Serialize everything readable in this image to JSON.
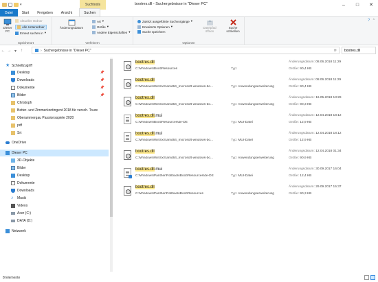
{
  "window": {
    "title": "bootres.dll - Suchergebnisse in \"Dieser PC\"",
    "context_tab_header": "Suchtools",
    "controls": [
      "–",
      "□",
      "✕"
    ]
  },
  "tabs": [
    {
      "label": "Datei"
    },
    {
      "label": "Start"
    },
    {
      "label": "Freigeben"
    },
    {
      "label": "Ansicht"
    },
    {
      "label": "Suchen"
    }
  ],
  "ribbon": {
    "location": {
      "group_label": "Speicherort",
      "this_pc": "Dieser PC",
      "current_folder": "Aktueller Ordner",
      "all_subfolders": "Alle Unterordner",
      "search_again": "Erneut suchen in"
    },
    "refine": {
      "group_label": "Verfeinern",
      "change_date": "Änderungsdatum",
      "kind": "Art",
      "size": "Größe",
      "other_properties": "Andere Eigenschaften"
    },
    "options": {
      "group_label": "Optionen",
      "recent_searches": "Zuletzt ausgeführte Suchvorgänge",
      "advanced_options": "Erweiterte Optionen",
      "save_search": "Suche speichern",
      "open_location": "Dateipfad öffnen",
      "close_search": "Suche schließen"
    }
  },
  "address": {
    "path": "Suchergebnisse in \"Dieser PC\"",
    "search_value": "bootres.dll"
  },
  "nav": {
    "quick_access": "Schnellzugriff",
    "items": [
      {
        "label": "Desktop",
        "pinned": true
      },
      {
        "label": "Downloads",
        "pinned": true
      },
      {
        "label": "Dokumente",
        "pinned": true
      },
      {
        "label": "Bilder",
        "pinned": true
      },
      {
        "label": "Christoph",
        "pinned": false
      },
      {
        "label": "Better- und Zimmerkontingent 2018 für versch. Toure",
        "pinned": false
      },
      {
        "label": "Oberammergau Passionsspiele 2020",
        "pinned": false
      },
      {
        "label": "pdf",
        "pinned": false
      },
      {
        "label": "Srt",
        "pinned": false
      }
    ],
    "onedrive": "OneDrive",
    "this_pc": "Dieser PC",
    "pc_items": [
      {
        "label": "3D-Objekte"
      },
      {
        "label": "Bilder"
      },
      {
        "label": "Desktop"
      },
      {
        "label": "Dokumente"
      },
      {
        "label": "Downloads"
      },
      {
        "label": "Musik"
      },
      {
        "label": "Videos"
      },
      {
        "label": "Acer (C:)"
      },
      {
        "label": "DATA (D:)"
      }
    ],
    "network": "Netzwerk"
  },
  "labels": {
    "type": "Typ:",
    "date": "Änderungsdatum:",
    "size": "Größe:"
  },
  "results": [
    {
      "name_hl": "bootres.dll",
      "name_rest": "",
      "path": "C:\\Windows\\Boot\\Resources",
      "type": "",
      "date": "08.06.2018 11:29",
      "size": "90,4 KB",
      "icon": "gear"
    },
    {
      "name_hl": "bootres.dll",
      "name_rest": "",
      "path": "C:\\Windows\\WinSxS\\amd64_microsoft-windows-bo...",
      "type": "Anwendungserweiterung",
      "date": "08.06.2018 11:29",
      "size": "90,4 KB",
      "icon": "gear"
    },
    {
      "name_hl": "bootres.dll",
      "name_rest": "",
      "path": "C:\\Windows\\WinSxS\\amd64_microsoft-windows-bo...",
      "type": "Anwendungserweiterung",
      "date": "16.05.2018 13:29",
      "size": "90,3 KB",
      "icon": "gear"
    },
    {
      "name_hl": "bootres.dll",
      "name_rest": ".mui",
      "path": "C:\\Windows\\Boot\\Resources\\de-DE",
      "type": "MUI-Datei",
      "date": "12.04.2018 18:12",
      "size": "12,9 KB",
      "icon": "doc"
    },
    {
      "name_hl": "bootres.dll",
      "name_rest": ".mui",
      "path": "C:\\Windows\\WinSxS\\amd64_microsoft-windows-bo...",
      "type": "MUI-Datei",
      "date": "12.04.2018 18:12",
      "size": "12,9 KB",
      "icon": "doc"
    },
    {
      "name_hl": "bootres.dll",
      "name_rest": "",
      "path": "C:\\Windows\\WinSxS\\amd64_microsoft-windows-bo...",
      "type": "Anwendungserweiterung",
      "date": "12.04.2018 01:34",
      "size": "90,9 KB",
      "icon": "gear"
    },
    {
      "name_hl": "bootres.dll",
      "name_rest": ".mui",
      "path": "C:\\Windows\\Panther\\Rollback\\Boot\\Resources\\de-DE",
      "type": "MUI-Datei",
      "date": "30.09.2017 16:04",
      "size": "12,4 KB",
      "icon": "blue"
    },
    {
      "name_hl": "bootres.dll",
      "name_rest": "",
      "path": "C:\\Windows\\Panther\\Rollback\\Boot\\Resources",
      "type": "Anwendungserweiterung",
      "date": "29.09.2017 15:37",
      "size": "90,3 KB",
      "icon": "gear"
    }
  ],
  "status": {
    "count": "8 Elemente"
  },
  "colors": {
    "accent": "#1979ca",
    "highlight": "#ffe98a",
    "selected": "#cce8ff",
    "context_tab": "#f5e49c"
  }
}
